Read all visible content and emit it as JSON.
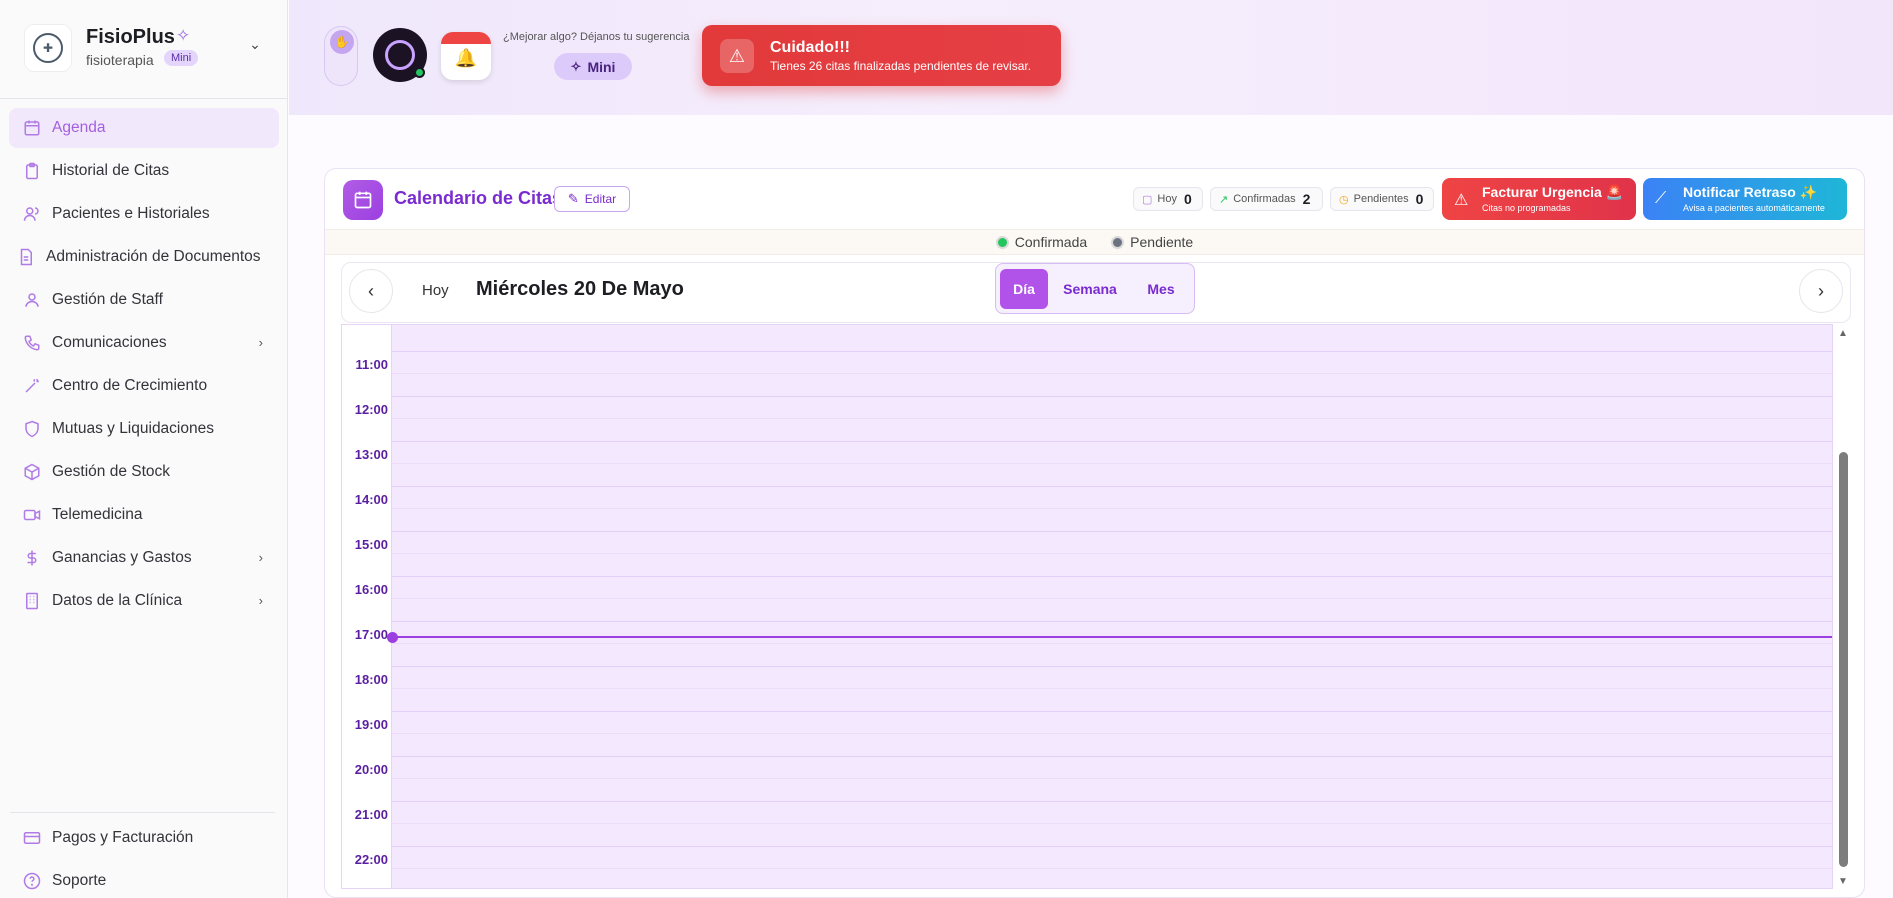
{
  "sidebar": {
    "brand_name": "FisioPlus",
    "brand_sub": "fisioterapia",
    "brand_badge": "Mini",
    "items": [
      {
        "label": "Agenda",
        "icon": "calendar-icon"
      },
      {
        "label": "Historial de Citas",
        "icon": "clipboard-icon"
      },
      {
        "label": "Pacientes e Historiales",
        "icon": "users-icon"
      },
      {
        "label": "Administración de Documentos",
        "icon": "document-icon"
      },
      {
        "label": "Gestión de Staff",
        "icon": "user-icon"
      },
      {
        "label": "Comunicaciones",
        "icon": "phone-icon"
      },
      {
        "label": "Centro de Crecimiento",
        "icon": "wand-icon"
      },
      {
        "label": "Mutuas y Liquidaciones",
        "icon": "shield-icon"
      },
      {
        "label": "Gestión de Stock",
        "icon": "box-icon"
      },
      {
        "label": "Telemedicina",
        "icon": "video-icon"
      },
      {
        "label": "Ganancias y Gastos",
        "icon": "dollar-icon"
      },
      {
        "label": "Datos de la Clínica",
        "icon": "building-icon"
      }
    ],
    "bottom_items": [
      {
        "label": "Pagos y Facturación",
        "icon": "credit-card-icon"
      },
      {
        "label": "Soporte",
        "icon": "help-circle-icon"
      }
    ]
  },
  "header": {
    "suggest_text": "¿Mejorar algo? Déjanos tu sugerencia",
    "mini_label": "Mini",
    "alert_title": "Cuidado!!!",
    "alert_message": "Tienes 26 citas finalizadas pendientes de revisar."
  },
  "calendar": {
    "title": "Calendario de Citas",
    "edit_label": "Editar",
    "stats": {
      "today_label": "Hoy",
      "today_value": "0",
      "confirmed_label": "Confirmadas",
      "confirmed_value": "2",
      "pending_label": "Pendientes",
      "pending_value": "0"
    },
    "urgent_title": "Facturar Urgencia 🚨",
    "urgent_sub": "Citas no programadas",
    "notify_title": "Notificar Retraso ✨",
    "notify_sub": "Avisa a pacientes automáticamente",
    "legend": [
      {
        "label": "Confirmada",
        "color": "#22c55e"
      },
      {
        "label": "Pendiente",
        "color": "#6b7280"
      }
    ],
    "today_button": "Hoy",
    "date_title": "Miércoles 20 De Mayo",
    "views": {
      "day": "Día",
      "week": "Semana",
      "month": "Mes"
    },
    "hours": [
      "11:00",
      "12:00",
      "13:00",
      "14:00",
      "15:00",
      "16:00",
      "17:00",
      "18:00",
      "19:00",
      "20:00",
      "21:00",
      "22:00"
    ]
  },
  "colors": {
    "accent": "#9b3fe0",
    "danger": "#ef4444",
    "info": "#3b82f6"
  }
}
